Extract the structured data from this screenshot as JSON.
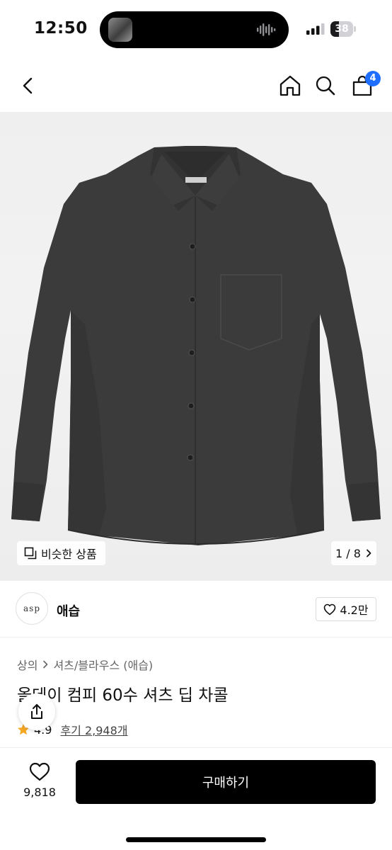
{
  "status_bar": {
    "time": "12:50",
    "battery_level": "38",
    "battery_fraction": 0.38
  },
  "nav": {
    "back_icon": "chevron-left-icon",
    "home_icon": "home-icon",
    "search_icon": "search-icon",
    "cart_icon": "shopping-bag-icon",
    "cart_count": "4",
    "accent_color": "#1e6fff"
  },
  "gallery": {
    "similar_label": "비슷한 상품",
    "page_indicator": "1 / 8"
  },
  "brand": {
    "logo_text": "asp",
    "name": "애습",
    "like_count": "4.2만"
  },
  "product": {
    "breadcrumb": [
      "상의",
      "셔츠/블라우스 (애습)"
    ],
    "title": "올데이 컴피 60수 셔츠 딥 차콜",
    "rating": "4.9",
    "reviews_label": "후기 2,948개"
  },
  "bottom": {
    "wish_count": "9,818",
    "buy_label": "구매하기"
  }
}
